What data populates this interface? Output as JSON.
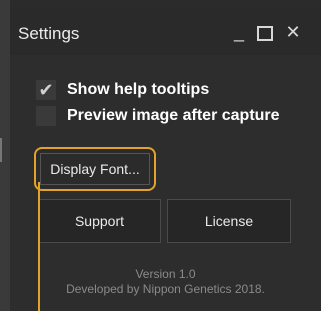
{
  "window": {
    "title": "Settings",
    "minimize_icon": "minimize-icon",
    "maximize_icon": "maximize-icon",
    "close_icon": "close-icon"
  },
  "options": [
    {
      "label": "Show help tooltips",
      "checked": true
    },
    {
      "label": "Preview image after capture",
      "checked": false
    }
  ],
  "buttons": {
    "display_font": "Display Font...",
    "support": "Support",
    "license": "License"
  },
  "footer": {
    "version": "Version 1.0",
    "developer": "Developed by Nippon Genetics 2018."
  },
  "colors": {
    "highlight": "#e3a22a",
    "background": "#2d2d2d"
  }
}
